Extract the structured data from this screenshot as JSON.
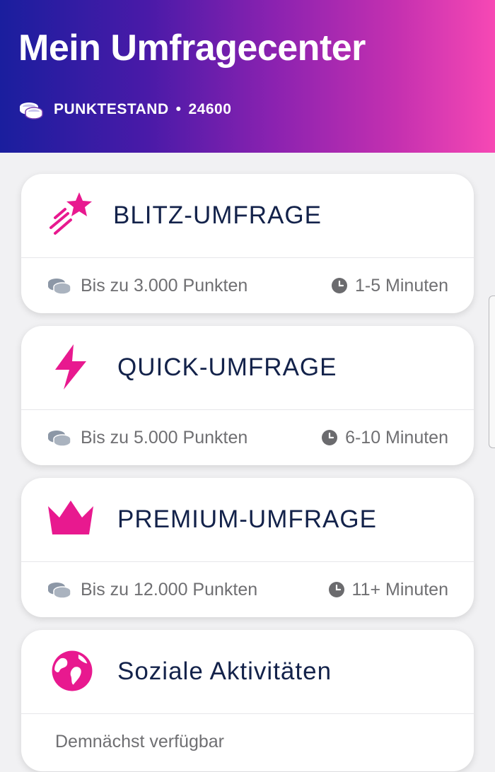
{
  "header": {
    "title": "Mein Umfragecenter",
    "points_label": "PUNKTESTAND",
    "points_separator": "•",
    "points_value": "24600"
  },
  "cards": [
    {
      "title": "BLITZ-UMFRAGE",
      "icon": "shooting-star-icon",
      "points_text": "Bis zu 3.000 Punkten",
      "duration": "1-5 Minuten"
    },
    {
      "title": "QUICK-UMFRAGE",
      "icon": "lightning-icon",
      "points_text": "Bis zu 5.000 Punkten",
      "duration": "6-10 Minuten"
    },
    {
      "title": "PREMIUM-UMFRAGE",
      "icon": "crown-icon",
      "points_text": "Bis zu 12.000 Punkten",
      "duration": "11+ Minuten"
    },
    {
      "title": "Soziale Aktivitäten",
      "icon": "globe-icon",
      "status": "Demnächst verfügbar"
    }
  ],
  "colors": {
    "accent_pink": "#e8198f",
    "title_navy": "#13224a",
    "gradient_start": "#1a1e9e",
    "gradient_end": "#f748b4"
  }
}
